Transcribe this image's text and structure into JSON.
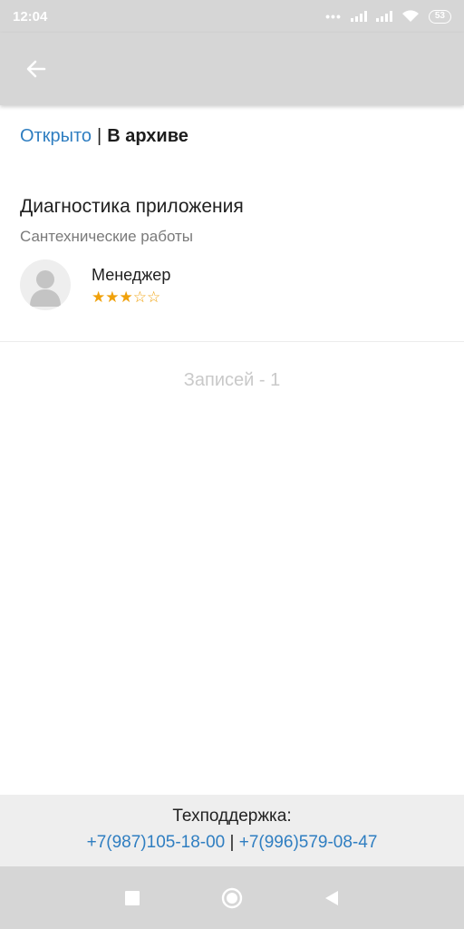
{
  "status_bar": {
    "time": "12:04",
    "battery": "53",
    "dots": "•••"
  },
  "tabs": {
    "open_label": "Открыто",
    "separator": "|",
    "archive_label": "В архиве",
    "active": "archive"
  },
  "record": {
    "title": "Диагностика приложения",
    "category": "Сантехнические работы",
    "manager": "Менеджер",
    "rating": 3,
    "rating_max": 5,
    "stars_full": "★★★",
    "stars_empty": "☆☆"
  },
  "list": {
    "count_text": "Записей - 1"
  },
  "support": {
    "label": "Техподдержка:",
    "phone1": "+7(987)105-18-00",
    "separator": "|",
    "phone2": "+7(996)579-08-47"
  },
  "colors": {
    "accent": "#2f7ec1",
    "star": "#f0a10b",
    "bar": "#d6d6d6"
  },
  "icons": {
    "back": "arrow-left-icon",
    "home": "circle-icon",
    "recents": "square-icon",
    "back_nav": "triangle-left-icon"
  }
}
